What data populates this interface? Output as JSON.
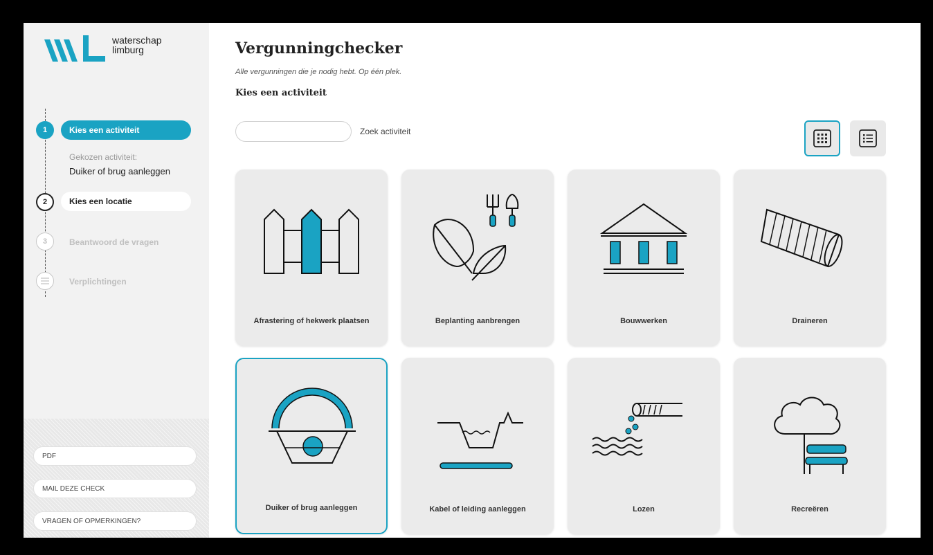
{
  "brand": {
    "line1": "waterschap",
    "line2": "limburg",
    "color": "#1aa3c3"
  },
  "steps": [
    {
      "number": "1",
      "label": "Kies een activiteit",
      "state": "active"
    },
    {
      "number": "2",
      "label": "Kies een locatie",
      "state": "current"
    },
    {
      "number": "3",
      "label": "Beantwoord de vragen",
      "state": "disabled"
    },
    {
      "number": "",
      "label": "Verplichtingen",
      "state": "disabled"
    }
  ],
  "chosen": {
    "label": "Gekozen activiteit:",
    "value": "Duiker of brug aanleggen"
  },
  "sidebar_buttons": {
    "pdf": "PDF",
    "mail": "MAIL DEZE CHECK",
    "questions": "VRAGEN OF OPMERKINGEN?"
  },
  "header": {
    "title": "Vergunningchecker",
    "subtitle": "Alle vergunningen die je nodig hebt. Op één plek.",
    "section": "Kies een activiteit"
  },
  "search": {
    "placeholder": "",
    "label": "Zoek activiteit"
  },
  "view_toggle": {
    "active": "grid"
  },
  "activities": [
    {
      "label": "Afrastering of hekwerk plaatsen",
      "icon": "fence-icon"
    },
    {
      "label": "Beplanting aanbrengen",
      "icon": "plant-icon"
    },
    {
      "label": "Bouwwerken",
      "icon": "building-icon"
    },
    {
      "label": "Draineren",
      "icon": "drain-pipe-icon"
    },
    {
      "label": "Duiker of brug aanleggen",
      "icon": "culvert-icon",
      "selected": true
    },
    {
      "label": "Kabel of leiding aanleggen",
      "icon": "cable-icon"
    },
    {
      "label": "Lozen",
      "icon": "discharge-icon"
    },
    {
      "label": "Recreëren",
      "icon": "recreation-icon"
    }
  ]
}
